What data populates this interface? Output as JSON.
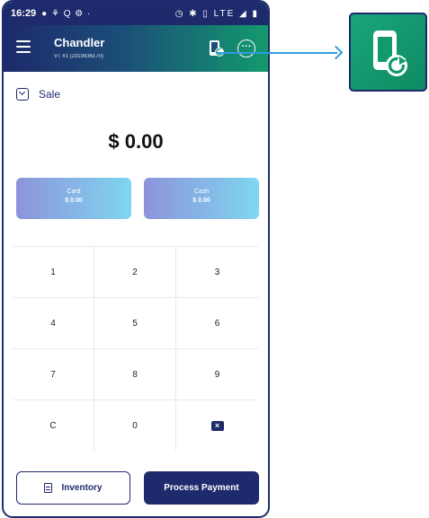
{
  "status_bar": {
    "time": "16:29",
    "left_icons": "● ⚘ Q ⚙ ·",
    "right_icons": "◷ ✱ ▯ LTE ◢ ▮"
  },
  "header": {
    "merchant_name": "Chandler",
    "terminal_id": "VT #1 (2319936170)",
    "more_label": "···"
  },
  "sale": {
    "label": "Sale"
  },
  "amount": {
    "value": "$ 0.00"
  },
  "tenders": [
    {
      "label": "Card",
      "value": "$ 0.00"
    },
    {
      "label": "Cash",
      "value": "$ 0.00"
    }
  ],
  "keypad": [
    "1",
    "2",
    "3",
    "4",
    "5",
    "6",
    "7",
    "8",
    "9",
    "C",
    "0",
    "⌫"
  ],
  "buttons": {
    "inventory": "Inventory",
    "process_payment": "Process Payment"
  },
  "icons": {
    "menu": "hamburger-menu-icon",
    "refresh": "phone-refresh-icon",
    "more": "more-options-icon",
    "sale": "checkbox-icon",
    "inventory": "clipboard-icon",
    "backspace": "backspace-icon"
  },
  "colors": {
    "primary": "#1d2a6b",
    "accent_green": "#139a6d",
    "callout": "#2f9be0",
    "tender_from": "#8d93d9",
    "tender_to": "#7fd6f1"
  }
}
